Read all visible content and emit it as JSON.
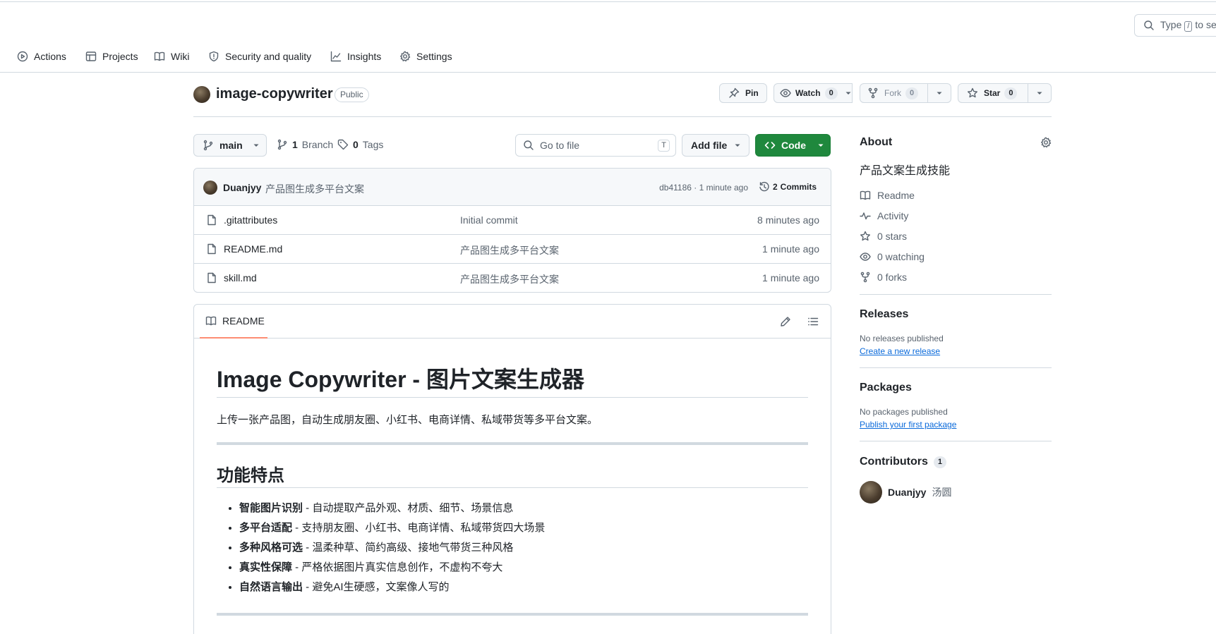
{
  "header": {
    "search_type": "Type",
    "search_key": "/",
    "search_rest": "to se",
    "nav": [
      {
        "label": "Actions",
        "icon": "play-icon"
      },
      {
        "label": "Projects",
        "icon": "table-icon"
      },
      {
        "label": "Wiki",
        "icon": "book-icon"
      },
      {
        "label": "Security and quality",
        "icon": "shield-icon"
      },
      {
        "label": "Insights",
        "icon": "graph-icon"
      },
      {
        "label": "Settings",
        "icon": "gear-icon"
      }
    ]
  },
  "repo": {
    "name": "image-copywriter",
    "visibility": "Public",
    "pin_label": "Pin",
    "watch_label": "Watch",
    "watch_count": "0",
    "fork_label": "Fork",
    "fork_count": "0",
    "star_label": "Star",
    "star_count": "0"
  },
  "branch_bar": {
    "branch": "main",
    "branch_count": "1",
    "branch_word": "Branch",
    "tag_count": "0",
    "tag_word": "Tags",
    "goto_placeholder": "Go to file",
    "goto_key": "T",
    "add_file": "Add file",
    "code": "Code"
  },
  "commit": {
    "author": "Duanjyy",
    "message": "产品图生成多平台文案",
    "meta": "db41186 · 1 minute ago",
    "commits_count": "2",
    "commits_word": "Commits"
  },
  "files": [
    {
      "name": ".gitattributes",
      "message": "Initial commit",
      "time": "8 minutes ago"
    },
    {
      "name": "README.md",
      "message": "产品图生成多平台文案",
      "time": "1 minute ago"
    },
    {
      "name": "skill.md",
      "message": "产品图生成多平台文案",
      "time": "1 minute ago"
    }
  ],
  "readme": {
    "tab": "README",
    "h1": "Image Copywriter - 图片文案生成器",
    "intro": "上传一张产品图，自动生成朋友圈、小红书、电商详情、私域带货等多平台文案。",
    "h2": "功能特点",
    "features": [
      {
        "bold": "智能图片识别",
        "text": " - 自动提取产品外观、材质、细节、场景信息"
      },
      {
        "bold": "多平台适配",
        "text": " - 支持朋友圈、小红书、电商详情、私域带货四大场景"
      },
      {
        "bold": "多种风格可选",
        "text": " - 温柔种草、简约高级、接地气带货三种风格"
      },
      {
        "bold": "真实性保障",
        "text": " - 严格依据图片真实信息创作，不虚构不夸大"
      },
      {
        "bold": "自然语言输出",
        "text": " - 避免AI生硬感，文案像人写的"
      }
    ]
  },
  "sidebar": {
    "about_title": "About",
    "description": "产品文案生成技能",
    "links": [
      {
        "label": "Readme",
        "icon": "book-icon"
      },
      {
        "label": "Activity",
        "icon": "pulse-icon"
      },
      {
        "label": "0 stars",
        "icon": "star-icon"
      },
      {
        "label": "0 watching",
        "icon": "eye-icon"
      },
      {
        "label": "0 forks",
        "icon": "fork-icon"
      }
    ],
    "releases_title": "Releases",
    "releases_empty": "No releases published",
    "releases_link": "Create a new release",
    "packages_title": "Packages",
    "packages_empty": "No packages published",
    "packages_link": "Publish your first package",
    "contributors_title": "Contributors",
    "contributors_count": "1",
    "contributor_login": "Duanjyy",
    "contributor_name": "汤圆"
  },
  "colors": {
    "accent_green": "#1f883d",
    "link_blue": "#0969da",
    "border": "#d1d9e0",
    "tab_underline": "#fd8c73"
  }
}
